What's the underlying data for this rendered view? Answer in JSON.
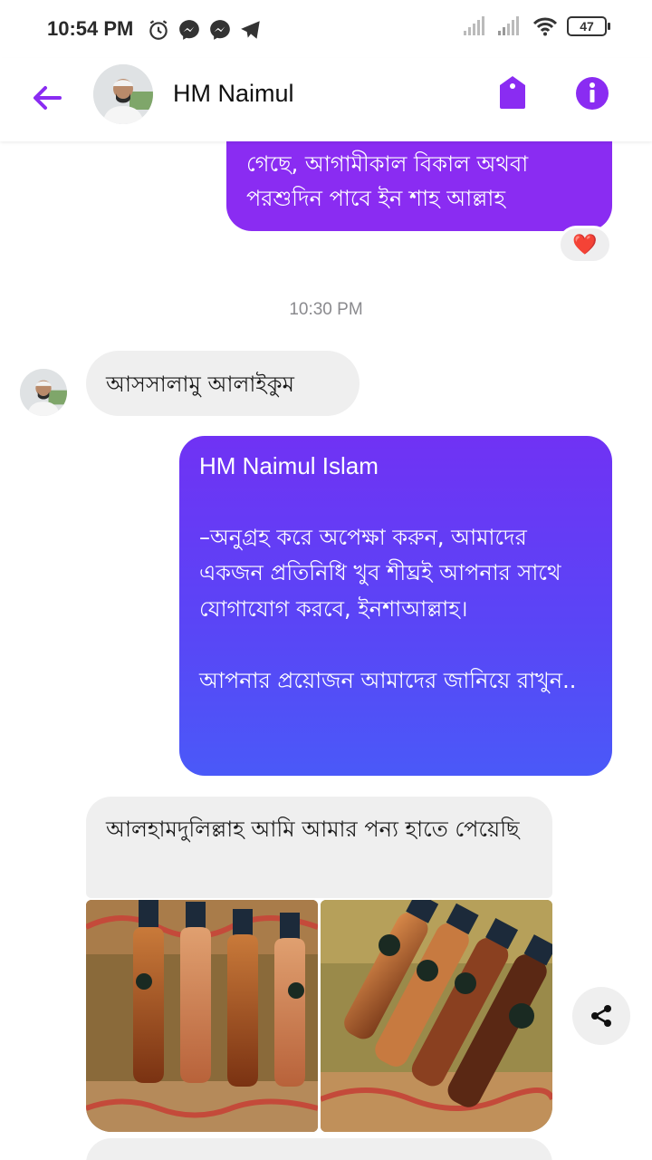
{
  "status_bar": {
    "time": "10:54 PM",
    "battery": "47",
    "left_icons": [
      "alarm-icon",
      "messenger-icon",
      "messenger-icon",
      "telegram-icon"
    ],
    "right_icons": [
      "signal-icon",
      "signal-icon",
      "wifi-icon",
      "battery-icon"
    ]
  },
  "header": {
    "contact_name": "HM Naimul",
    "accent_color": "#8a2cf2",
    "icons": [
      "back-arrow-icon",
      "tag-icon",
      "info-icon"
    ]
  },
  "messages": {
    "m1_partial": "গেছে, আগামীকাল বিকাল অথবা পরশুদিন পাবে ইন শাহ আল্লাহ",
    "m1_reaction": "❤️",
    "timestamp": "10:30 PM",
    "m2": "আসসালামু আলাইকুম",
    "m3_signature": "HM Naimul Islam",
    "m3_body": "–অনুগ্রহ করে অপেক্ষা করুন, আমাদের একজন প্রতিনিধি খুব শীঘ্রই আপনার সাথে যোগাযোগ করবে, ইনশাআল্লাহ।\n\nআপনার প্রয়োজন আমাদের জানিয়ে রাখুন..",
    "m4": "আলহামদুলিল্লাহ আমি আমার পন্য হাতে পেয়েছি"
  }
}
